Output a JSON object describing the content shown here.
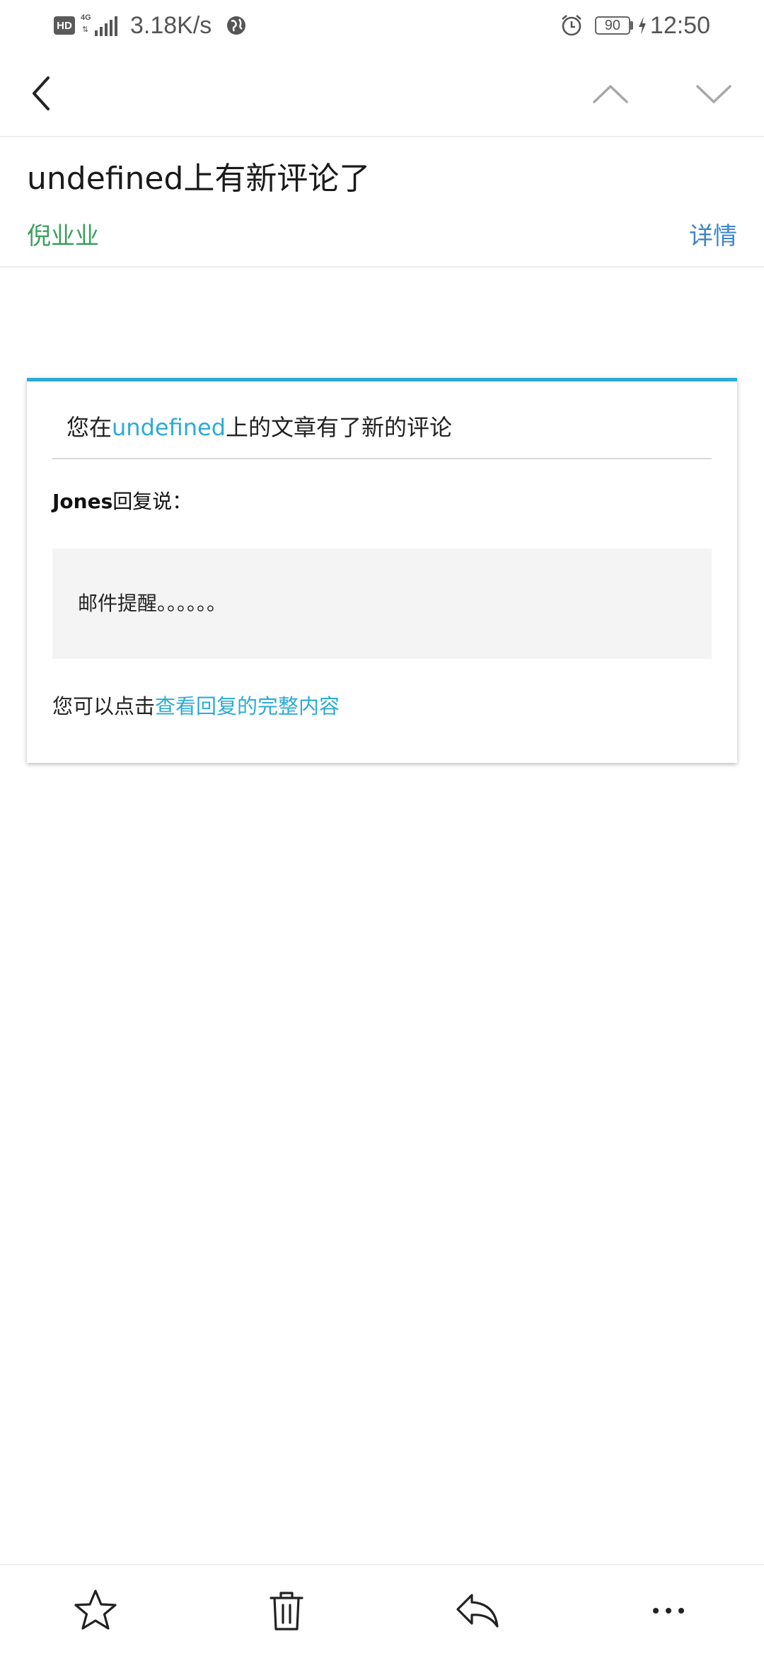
{
  "status_bar": {
    "hd_badge": "HD",
    "network_type": "4G",
    "speed": "3.18K/s",
    "battery": "90",
    "time": "12:50",
    "icons": [
      "hd-icon",
      "signal-icon",
      "globe-icon",
      "alarm-icon",
      "battery-icon",
      "charging-icon"
    ]
  },
  "toolbar": {
    "icons": [
      "back-arrow-icon",
      "previous-chevron-up-icon",
      "next-chevron-down-icon"
    ]
  },
  "mail": {
    "subject": "undefined上有新评论了",
    "sender": "倪业业",
    "details_label": "详情"
  },
  "card": {
    "title_prefix": "您在",
    "title_site": "undefined",
    "title_suffix": "上的文章有了新的评论",
    "reply_user": "Jones",
    "reply_suffix": "回复说：",
    "quote": "邮件提醒。。。。。。",
    "footer_prefix": "您可以点击",
    "footer_link": "查看回复的完整内容",
    "accent_color": "#2cabd6"
  },
  "bottom_bar": {
    "icons": [
      "star-icon",
      "trash-icon",
      "reply-icon",
      "more-icon"
    ]
  },
  "colors": {
    "sender": "#3aa05f",
    "details": "#3f86c8",
    "accent": "#2cabd6"
  }
}
